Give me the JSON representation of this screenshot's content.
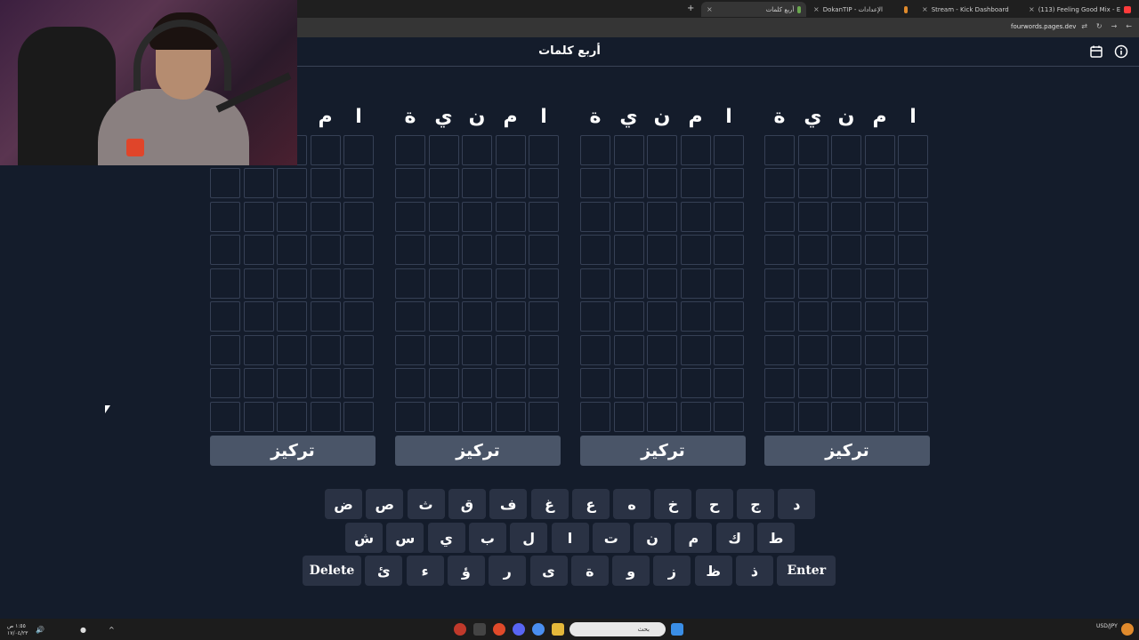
{
  "browser": {
    "tabs": [
      {
        "label": "(113) Feeling Good Mix - E",
        "color": "#ff3b3b"
      },
      {
        "label": "Stream - Kick Dashboard",
        "color": "#53fc18"
      },
      {
        "label": "DokanTIP - الإعدادات",
        "color": "#e08a2c"
      },
      {
        "label": "أربع كلمات",
        "color": "#6aa84f"
      }
    ],
    "url": "fourwords.pages.dev"
  },
  "app": {
    "title": "أربع كلمات",
    "calendar_icon": "calendar-icon",
    "info_icon": "info-icon"
  },
  "boards": [
    {
      "letters": [
        "ة",
        "ي",
        "ن",
        "م",
        "ا"
      ],
      "focus_label": "تركيز"
    },
    {
      "letters": [
        "ة",
        "ي",
        "ن",
        "م",
        "ا"
      ],
      "focus_label": "تركيز"
    },
    {
      "letters": [
        "ة",
        "ي",
        "ن",
        "م",
        "ا"
      ],
      "focus_label": "تركيز"
    },
    {
      "letters": [
        "",
        "",
        "",
        "م",
        "ا"
      ],
      "focus_label": "تركيز"
    }
  ],
  "keyboard": {
    "row1": [
      "ض",
      "ص",
      "ث",
      "ق",
      "ف",
      "غ",
      "ع",
      "ه",
      "خ",
      "ح",
      "ج",
      "د"
    ],
    "row2": [
      "ش",
      "س",
      "ي",
      "ب",
      "ل",
      "ا",
      "ت",
      "ن",
      "م",
      "ك",
      "ط"
    ],
    "row3": [
      "Delete",
      "ئ",
      "ء",
      "ؤ",
      "ر",
      "ى",
      "ة",
      "و",
      "ز",
      "ظ",
      "ذ",
      "Enter"
    ]
  },
  "taskbar": {
    "search_placeholder": "بحث",
    "currency": "USD/JPY",
    "time": "١:٥٥ ص",
    "date": "١٧/٠٤/٢٣"
  }
}
